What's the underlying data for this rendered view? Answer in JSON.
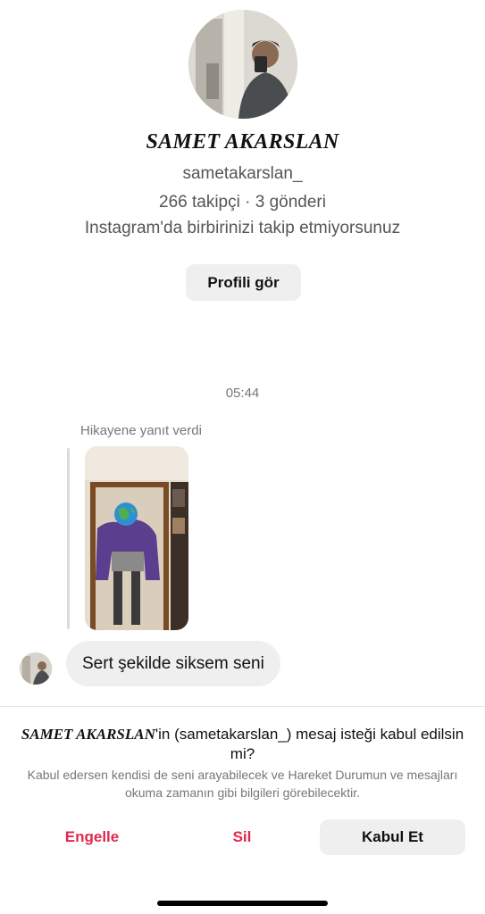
{
  "profile": {
    "name": "SAMET AKARSLAN",
    "username": "sametakarslan_",
    "stats": "266 takipçi · 3 gönderi",
    "follow_status": "Instagram'da birbirinizi takip etmiyorsunuz",
    "view_profile_label": "Profili gör"
  },
  "conversation": {
    "timestamp": "05:44",
    "story_reply_label": "Hikayene yanıt verdi",
    "message": "Sert şekilde siksem seni"
  },
  "request": {
    "name": "SAMET AKARSLAN",
    "title_rest": "'in (sametakarslan_) mesaj isteği kabul edilsin mi?",
    "description": "Kabul edersen kendisi de seni arayabilecek ve Hareket Durumun ve mesajları okuma zamanın gibi bilgileri görebilecektir.",
    "block_label": "Engelle",
    "delete_label": "Sil",
    "accept_label": "Kabul Et"
  },
  "colors": {
    "danger": "#e0284e",
    "button_bg": "#efefef",
    "muted_text": "#777777"
  }
}
